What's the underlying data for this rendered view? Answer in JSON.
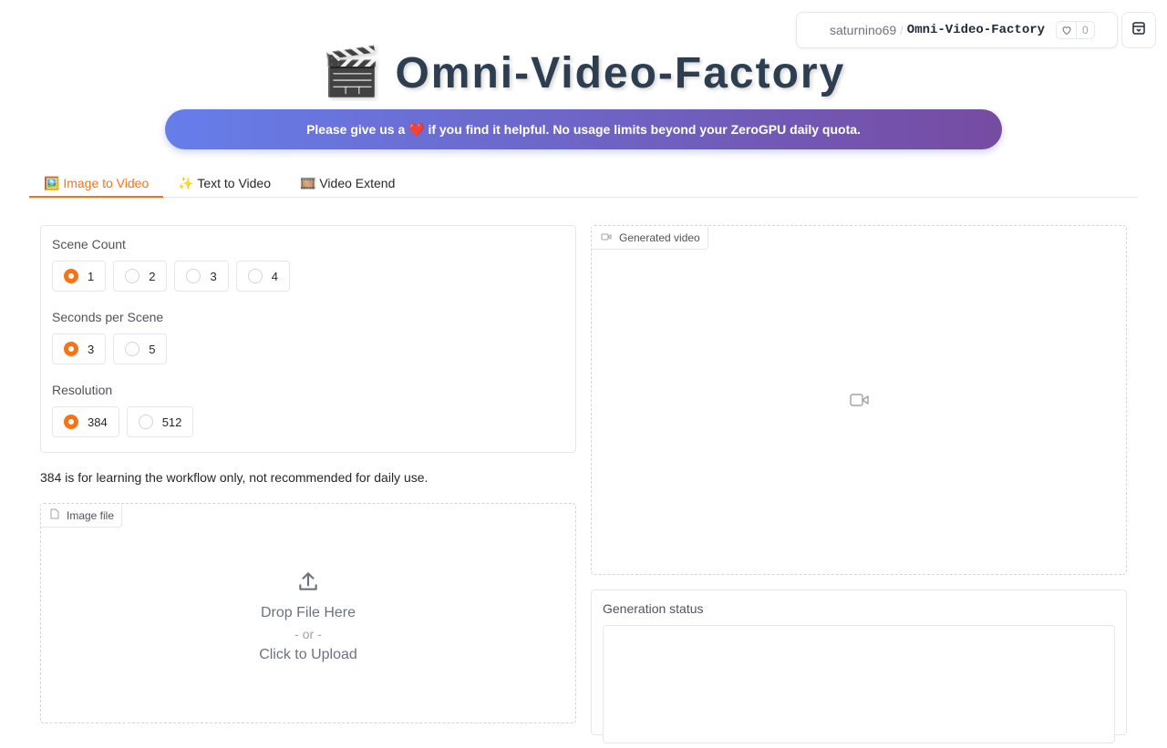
{
  "space": {
    "owner": "saturnino69",
    "separator": "/",
    "name": "Omni-Video-Factory",
    "likes": "0"
  },
  "header": {
    "icon": "🎬",
    "title": "Omni-Video-Factory",
    "banner": "Please give us a ❤️ if you find it helpful. No usage limits beyond your ZeroGPU daily quota."
  },
  "tabs": [
    {
      "label": "🖼️ Image to Video",
      "active": true
    },
    {
      "label": "✨ Text to Video",
      "active": false
    },
    {
      "label": "🎞️ Video Extend",
      "active": false
    }
  ],
  "settings": {
    "scene_count": {
      "label": "Scene Count",
      "options": [
        "1",
        "2",
        "3",
        "4"
      ],
      "selected": "1"
    },
    "seconds_per_scene": {
      "label": "Seconds per Scene",
      "options": [
        "3",
        "5"
      ],
      "selected": "3"
    },
    "resolution": {
      "label": "Resolution",
      "options": [
        "384",
        "512"
      ],
      "selected": "384"
    }
  },
  "note": "384 is for learning the workflow only, not recommended for daily use.",
  "upload": {
    "label": "Image file",
    "drop_text": "Drop File Here",
    "or_text": "- or -",
    "click_text": "Click to Upload"
  },
  "video": {
    "label": "Generated video"
  },
  "status": {
    "label": "Generation status",
    "value": ""
  },
  "colors": {
    "accent": "#f97316",
    "banner_start": "#667eea",
    "banner_end": "#764ba2",
    "title": "#2d3e50"
  }
}
